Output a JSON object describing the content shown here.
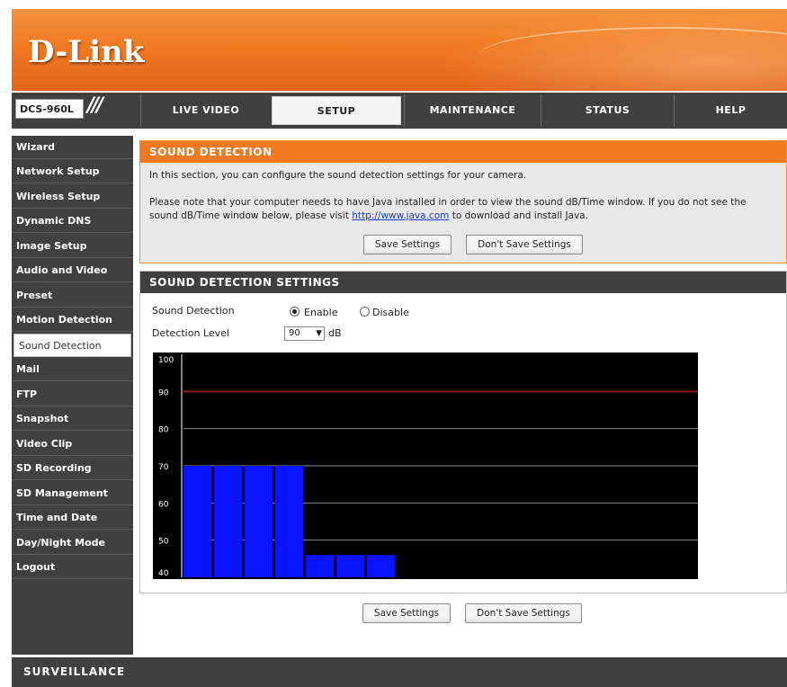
{
  "header": {
    "logo": "D-Link",
    "model": "DCS-960L",
    "model_slashes": "///"
  },
  "nav": {
    "tabs": [
      {
        "label": "LIVE VIDEO",
        "active": false
      },
      {
        "label": "SETUP",
        "active": true
      },
      {
        "label": "MAINTENANCE",
        "active": false
      },
      {
        "label": "STATUS",
        "active": false
      },
      {
        "label": "HELP",
        "active": false
      }
    ]
  },
  "sidebar": {
    "items": [
      {
        "label": "Wizard",
        "active": false
      },
      {
        "label": "Network Setup",
        "active": false
      },
      {
        "label": "Wireless Setup",
        "active": false
      },
      {
        "label": "Dynamic DNS",
        "active": false
      },
      {
        "label": "Image Setup",
        "active": false
      },
      {
        "label": "Audio and Video",
        "active": false
      },
      {
        "label": "Preset",
        "active": false
      },
      {
        "label": "Motion Detection",
        "active": false
      },
      {
        "label": "Sound Detection",
        "active": true
      },
      {
        "label": "Mail",
        "active": false
      },
      {
        "label": "FTP",
        "active": false
      },
      {
        "label": "Snapshot",
        "active": false
      },
      {
        "label": "Video Clip",
        "active": false
      },
      {
        "label": "SD Recording",
        "active": false
      },
      {
        "label": "SD Management",
        "active": false
      },
      {
        "label": "Time and Date",
        "active": false
      },
      {
        "label": "Day/Night Mode",
        "active": false
      },
      {
        "label": "Logout",
        "active": false
      }
    ]
  },
  "intro": {
    "title": "SOUND DETECTION",
    "line1": "In this section, you can configure the sound detection settings for your camera.",
    "line2": "Please note that your computer needs to have Java installed in order to view the sound dB/Time window. If you do not see the",
    "line3_pre": "sound dB/Time window below, please visit ",
    "line3_link": "http://www.java.com",
    "line3_post": " to download and install Java.",
    "save_label": "Save Settings",
    "dont_save_label": "Don't Save Settings"
  },
  "settings": {
    "title": "SOUND DETECTION SETTINGS",
    "sound_detection_label": "Sound Detection",
    "enable_label": "Enable",
    "disable_label": "Disable",
    "enabled": true,
    "detection_level_label": "Detection Level",
    "detection_level_value": "90",
    "detection_level_unit": "dB"
  },
  "bottom": {
    "save_label": "Save Settings",
    "dont_save_label": "Don't Save Settings"
  },
  "footer": {
    "brand": "SURVEILLANCE"
  },
  "chart_data": {
    "type": "bar",
    "ylim": [
      40,
      100
    ],
    "yticks": [
      100,
      90,
      80,
      70,
      60,
      50,
      40
    ],
    "threshold": 90,
    "values": [
      70,
      70,
      70,
      70,
      46,
      46,
      46
    ],
    "colors": {
      "bar": "#0a14ff",
      "threshold": "#8b1a1a",
      "grid": "#8a8a8a",
      "background": "#000000",
      "tick": "#ffffff"
    }
  }
}
